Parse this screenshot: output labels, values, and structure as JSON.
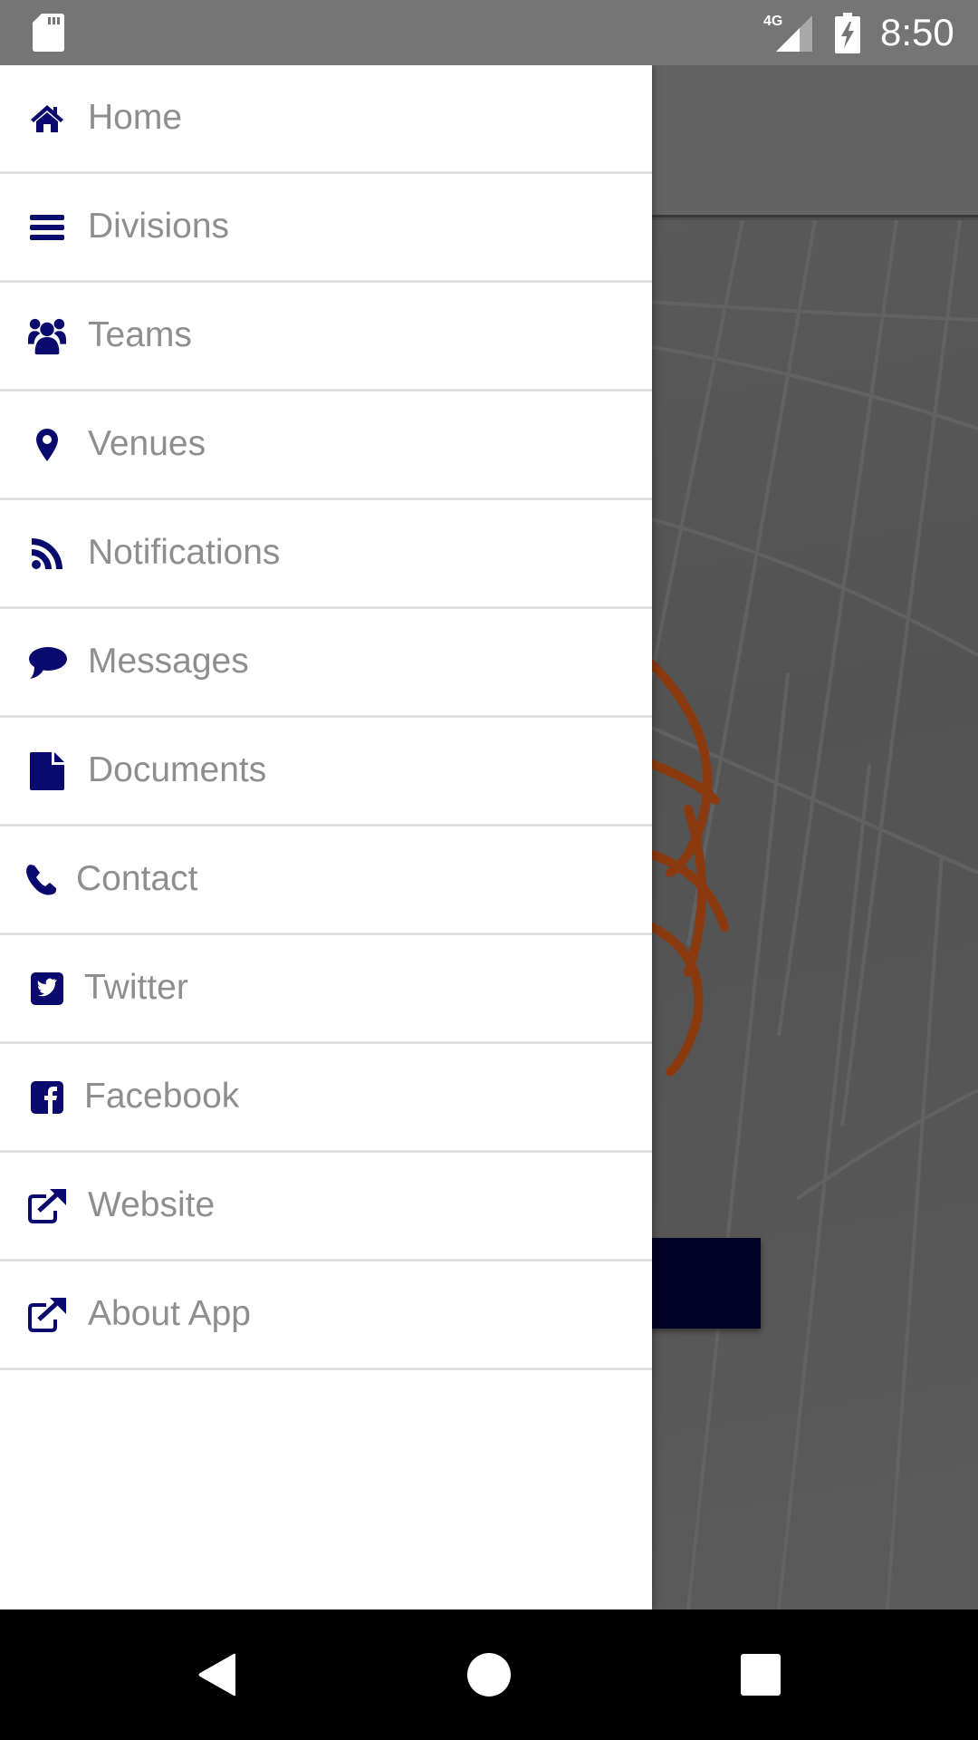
{
  "status_bar": {
    "time": "8:50",
    "network_label": "4G",
    "icons": [
      "sd-card-icon",
      "signal-4g-icon",
      "battery-charging-icon"
    ]
  },
  "drawer": {
    "items": [
      {
        "label": "Home",
        "icon": "home-icon"
      },
      {
        "label": "Divisions",
        "icon": "bars-icon"
      },
      {
        "label": "Teams",
        "icon": "users-icon"
      },
      {
        "label": "Venues",
        "icon": "map-marker-icon"
      },
      {
        "label": "Notifications",
        "icon": "rss-icon"
      },
      {
        "label": "Messages",
        "icon": "comment-icon"
      },
      {
        "label": "Documents",
        "icon": "file-icon"
      },
      {
        "label": "Contact",
        "icon": "phone-icon"
      },
      {
        "label": "Twitter",
        "icon": "twitter-square-icon"
      },
      {
        "label": "Facebook",
        "icon": "facebook-square-icon"
      },
      {
        "label": "Website",
        "icon": "external-link-icon"
      },
      {
        "label": "About App",
        "icon": "external-link-icon"
      }
    ]
  },
  "nav_bar": {
    "buttons": [
      "back",
      "home",
      "recents"
    ]
  },
  "colors": {
    "icon_accent": "#0a0a6e",
    "label_text": "#8e8e8e",
    "divider": "#e0e0e0",
    "status_bar": "#757575",
    "scrim_button": "#000022",
    "basketball": "#8b3a10"
  }
}
